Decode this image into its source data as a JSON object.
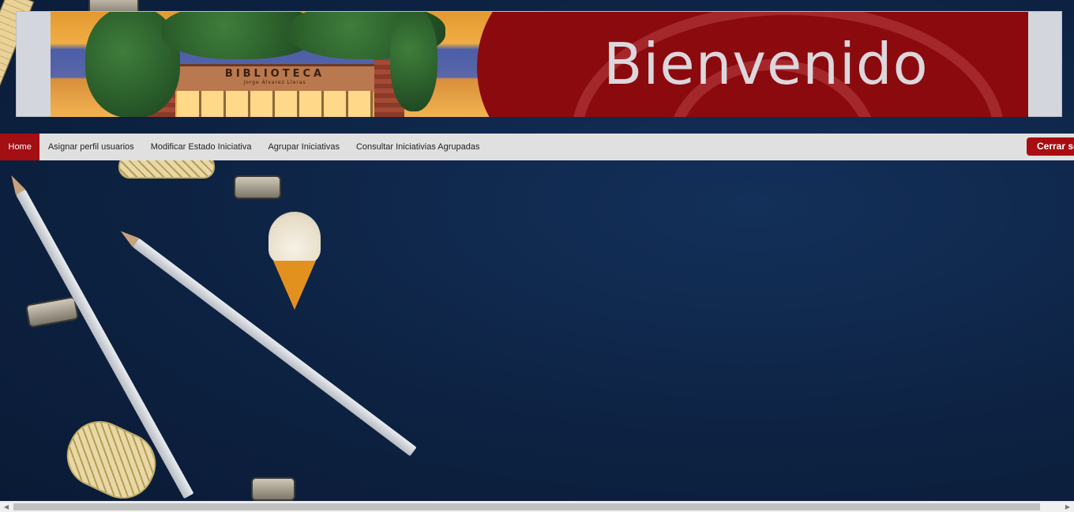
{
  "header": {
    "welcome_text": "Bienvenido",
    "library_sign": "BIBLIOTECA",
    "library_subsign": "Jorge Álvarez Lleras"
  },
  "nav": {
    "items": [
      {
        "label": "Home",
        "active": true
      },
      {
        "label": "Asignar perfil usuarios",
        "active": false
      },
      {
        "label": "Modificar Estado Iniciativa",
        "active": false
      },
      {
        "label": "Agrupar Iniciativas",
        "active": false
      },
      {
        "label": "Consultar Iniciativias Agrupadas",
        "active": false
      }
    ],
    "logout_label": "Cerrar sesión"
  },
  "scrollbar": {
    "left_arrow": "◀",
    "right_arrow": "▶"
  },
  "colors": {
    "brand_red": "#a30f12",
    "nav_bg": "#e0e0e0",
    "page_bg": "#0e2445"
  }
}
